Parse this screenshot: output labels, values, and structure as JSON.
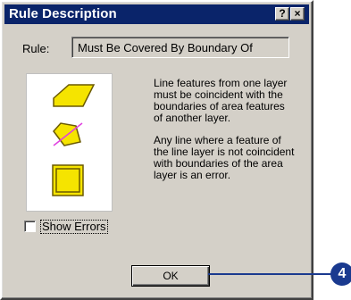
{
  "window": {
    "title": "Rule Description",
    "help_button": "?",
    "close_button": "×"
  },
  "rule": {
    "label": "Rule:",
    "value": "Must Be Covered By Boundary Of"
  },
  "symbols": {
    "icons": [
      "parallelogram-area-icon",
      "line-overlay-area-icon",
      "bordered-square-icon"
    ],
    "fill_color": "#f5e400",
    "outline_color": "#6b5a00",
    "line_color": "#e040e0"
  },
  "description": {
    "paragraph1": "Line features from one layer must be coincident with the boundaries of area features of another layer.",
    "paragraph2": "Any line where a feature of the line layer is not coincident with boundaries of the area layer is an error."
  },
  "show_errors": {
    "label": "Show Errors",
    "checked": false
  },
  "ok_button": {
    "label": "OK"
  },
  "callout": {
    "number": "4"
  }
}
